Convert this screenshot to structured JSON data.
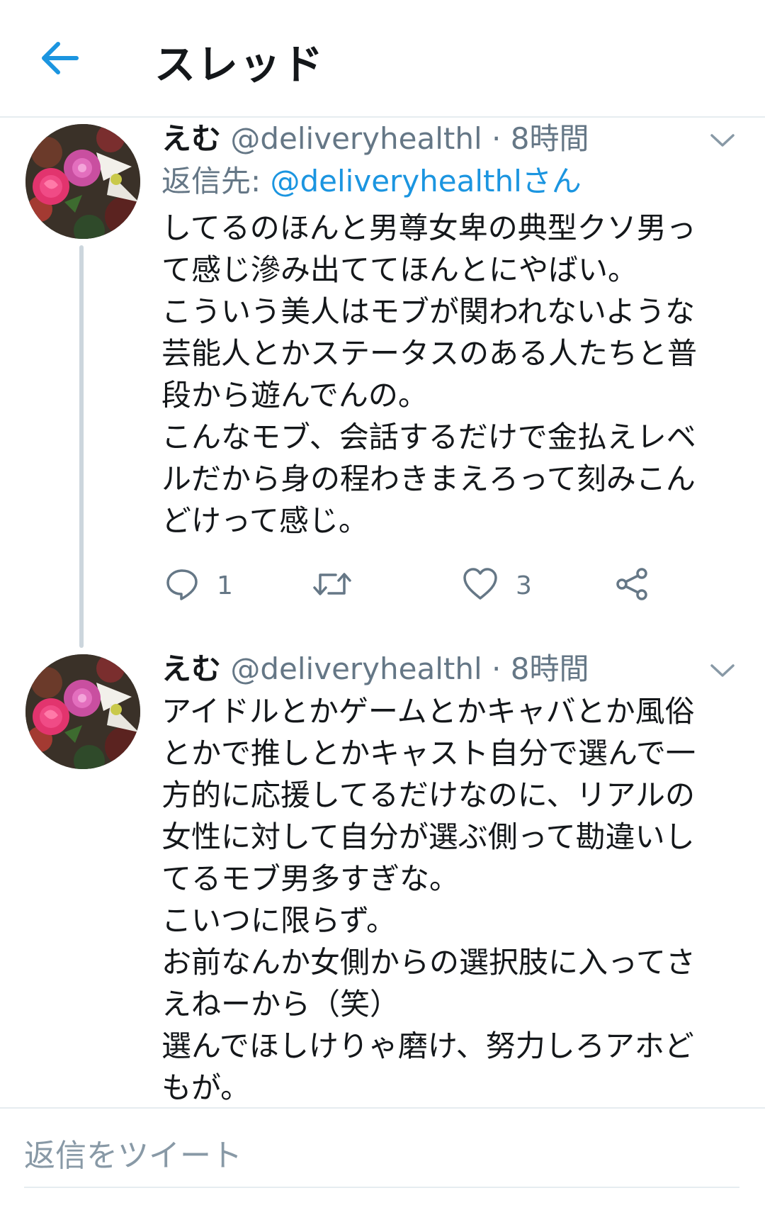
{
  "header": {
    "title": "スレッド"
  },
  "tweets": [
    {
      "display_name": "えむ",
      "handle": "@deliveryhealthl",
      "separator": "·",
      "time": "8時間",
      "reply_prefix": "返信先:",
      "reply_mention": "@deliveryhealthlさん",
      "text": "してるのほんと男尊女卑の典型クソ男っ\nて感じ滲み出ててほんとにやばい。\nこういう美人はモブが関われないような\n芸能人とかステータスのある人たちと普\n段から遊んでんの。\nこんなモブ、会話するだけで金払えレベ\nルだから身の程わきまえろって刻みこん\nどけって感じ。",
      "reply_count": "1",
      "like_count": "3"
    },
    {
      "display_name": "えむ",
      "handle": "@deliveryhealthl",
      "separator": "·",
      "time": "8時間",
      "text": "アイドルとかゲームとかキャバとか風俗\nとかで推しとかキャスト自分で選んで一\n方的に応援してるだけなのに、リアルの\n女性に対して自分が選ぶ側って勘違いし\nてるモブ男多すぎな。\nこいつに限らず。\nお前なんか女側からの選択肢に入ってさ\nえねーから（笑）\n選んでほしけりゃ磨け、努力しろアホど\nもが。"
    }
  ],
  "compose": {
    "placeholder": "返信をツイート"
  },
  "colors": {
    "accent": "#1b95e0",
    "secondary_text": "#657786",
    "border": "#e6ecf0"
  },
  "icons": {
    "back": "arrow-left-icon",
    "caret": "chevron-down-icon",
    "reply": "reply-bubble-icon",
    "retweet": "retweet-icon",
    "like": "heart-icon",
    "share": "share-icon"
  }
}
